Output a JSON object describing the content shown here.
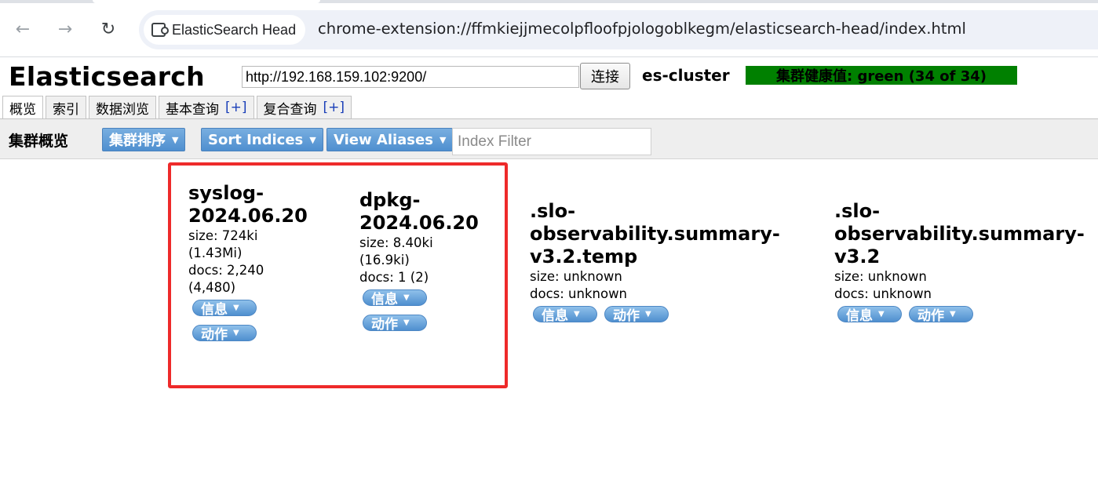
{
  "browser": {
    "tab_chip_label": "ElasticSearch Head",
    "address": "chrome-extension://ffmkiejjmecolpfloofpjologoblkegm/elasticsearch-head/index.html",
    "back_glyph": "←",
    "forward_glyph": "→",
    "reload_glyph": "↻"
  },
  "app": {
    "title": "Elasticsearch",
    "url_value": "http://192.168.159.102:9200/",
    "connect_label": "连接",
    "cluster_name": "es-cluster",
    "health_text": "集群健康值: green (34 of 34)",
    "health_color": "#008000"
  },
  "tabs": [
    {
      "label": "概览",
      "plus": ""
    },
    {
      "label": "索引",
      "plus": ""
    },
    {
      "label": "数据浏览",
      "plus": ""
    },
    {
      "label": "基本查询",
      "plus": "[+]"
    },
    {
      "label": "复合查询",
      "plus": "[+]"
    }
  ],
  "toolbar": {
    "title": "集群概览",
    "sort_cluster_label": "集群排序",
    "sort_indices_label": "Sort Indices",
    "view_aliases_label": "View Aliases",
    "filter_placeholder": "Index Filter"
  },
  "indices": [
    {
      "name_line1": "syslog-",
      "name_line2": "2024.06.20",
      "size_line1": "size: 724ki",
      "size_line2": "(1.43Mi)",
      "docs_line1": "docs: 2,240",
      "docs_line2": "(4,480)",
      "info_label": "信息",
      "action_label": "动作"
    },
    {
      "name_line1": "dpkg-",
      "name_line2": "2024.06.20",
      "size_line1": "size: 8.40ki",
      "size_line2": "(16.9ki)",
      "docs_line1": "docs: 1 (2)",
      "info_label": "信息",
      "action_label": "动作"
    },
    {
      "name_line1": ".slo-",
      "name_line2": "observability.summary-",
      "name_line3": "v3.2.temp",
      "size_line1": "size: unknown",
      "docs_line1": "docs: unknown",
      "info_label": "信息",
      "action_label": "动作"
    },
    {
      "name_line1": ".slo-",
      "name_line2": "observability.summary-",
      "name_line3": "v3.2",
      "size_line1": "size: unknown",
      "docs_line1": "docs: unknown",
      "info_label": "信息",
      "action_label": "动作"
    }
  ],
  "caret_glyph": "▼"
}
